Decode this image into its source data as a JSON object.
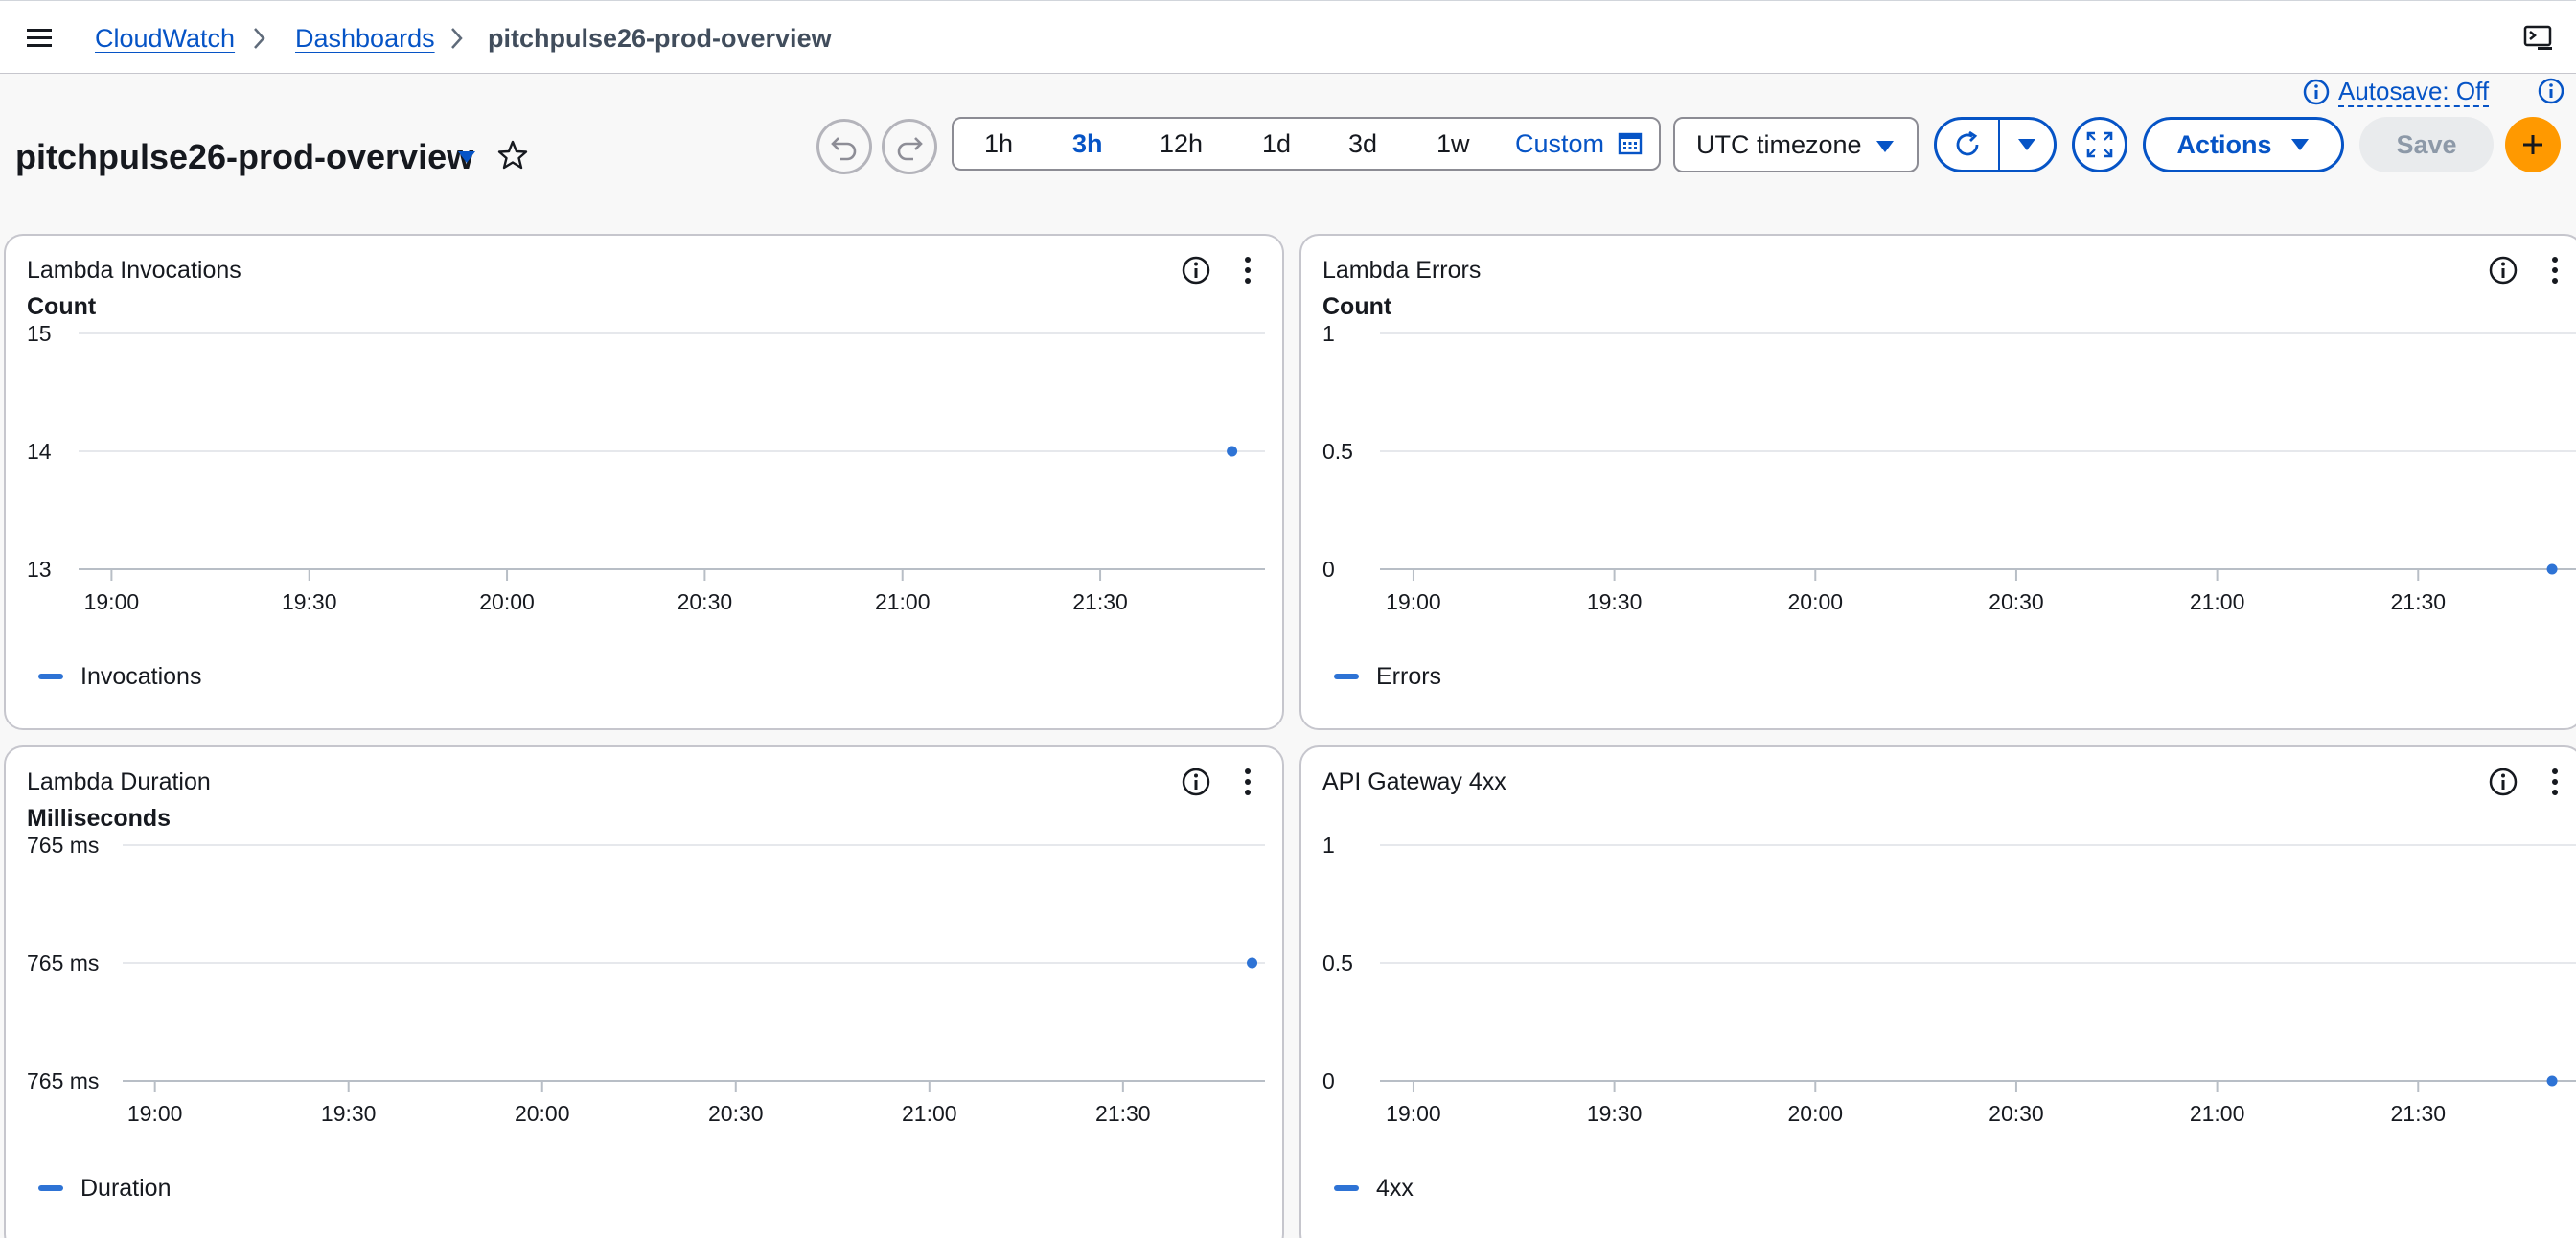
{
  "nav": {
    "breadcrumbs": [
      "CloudWatch",
      "Dashboards",
      "pitchpulse26-prod-overview"
    ]
  },
  "autosave": {
    "label": "Autosave: Off"
  },
  "dashboard": {
    "title": "pitchpulse26-prod-overview"
  },
  "toolbar": {
    "time_ranges": [
      "1h",
      "3h",
      "12h",
      "1d",
      "3d",
      "1w"
    ],
    "active_range": "3h",
    "custom_label": "Custom",
    "timezone": "UTC timezone",
    "actions_label": "Actions",
    "save_label": "Save"
  },
  "colors": {
    "accent": "#0654c6",
    "series": "#2e73d5",
    "add_button": "#ff9900"
  },
  "widgets": [
    {
      "title": "Lambda Invocations",
      "unit": "Count",
      "legend": "Invocations"
    },
    {
      "title": "Lambda Errors",
      "unit": "Count",
      "legend": "Errors"
    },
    {
      "title": "Lambda Duration",
      "unit": "Milliseconds",
      "legend": "Duration"
    },
    {
      "title": "API Gateway 4xx",
      "unit": "",
      "legend": "4xx"
    }
  ],
  "chart_data": [
    {
      "type": "line",
      "x_ticks": [
        "19:00",
        "19:30",
        "20:00",
        "20:30",
        "21:00",
        "21:30"
      ],
      "xlim": [
        "18:55",
        "21:55"
      ],
      "y_ticks": [
        "15",
        "14",
        "13"
      ],
      "ylim": [
        13,
        15
      ],
      "series": [
        {
          "name": "Invocations",
          "points": [
            {
              "x": "21:50",
              "y": 14
            }
          ]
        }
      ]
    },
    {
      "type": "line",
      "x_ticks": [
        "19:00",
        "19:30",
        "20:00",
        "20:30",
        "21:00",
        "21:30"
      ],
      "xlim": [
        "18:55",
        "21:55"
      ],
      "y_ticks": [
        "1",
        "0.5",
        "0"
      ],
      "ylim": [
        0,
        1
      ],
      "series": [
        {
          "name": "Errors",
          "points": [
            {
              "x": "21:50",
              "y": 0
            }
          ]
        }
      ]
    },
    {
      "type": "line",
      "x_ticks": [
        "19:00",
        "19:30",
        "20:00",
        "20:30",
        "21:00",
        "21:30"
      ],
      "xlim": [
        "18:55",
        "21:52"
      ],
      "y_ticks": [
        "765 ms",
        "765 ms",
        "765 ms"
      ],
      "ylim": [
        0,
        1
      ],
      "series": [
        {
          "name": "Duration",
          "points": [
            {
              "x": "21:50",
              "y": 0.5
            }
          ]
        }
      ]
    },
    {
      "type": "line",
      "x_ticks": [
        "19:00",
        "19:30",
        "20:00",
        "20:30",
        "21:00",
        "21:30"
      ],
      "xlim": [
        "18:55",
        "21:55"
      ],
      "y_ticks": [
        "1",
        "0.5",
        "0"
      ],
      "ylim": [
        0,
        1
      ],
      "series": [
        {
          "name": "4xx",
          "points": [
            {
              "x": "21:50",
              "y": 0
            }
          ]
        }
      ]
    }
  ]
}
